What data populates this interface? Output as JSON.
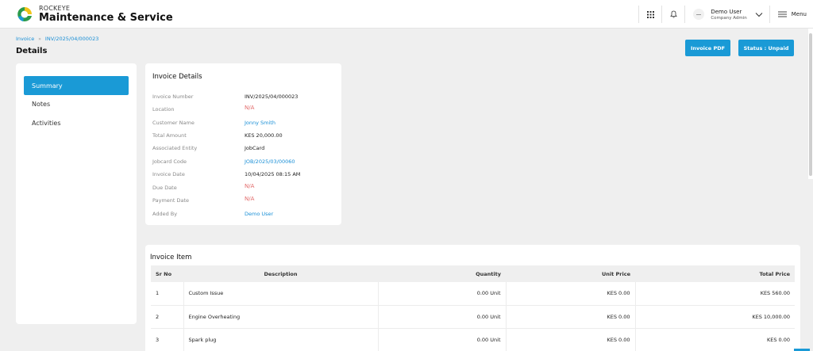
{
  "header": {
    "brand_top": "ROCKEYE",
    "brand_main": "Maintenance & Service",
    "user_name": "Demo User",
    "user_role": "Company Admin",
    "menu_label": "Menu",
    "icons": [
      "rockeye-logo-icon",
      "apps-grid-icon",
      "bell-icon",
      "avatar",
      "chevron-down-icon",
      "hamburger-menu-icon"
    ]
  },
  "breadcrumb": {
    "root": "Invoice",
    "current": "INV/2025/04/000023"
  },
  "page_title": "Details",
  "actions": {
    "invoice_pdf": "Invoice PDF",
    "status": "Status : Unpaid"
  },
  "sidebar": {
    "items": [
      {
        "label": "Summary",
        "active": true
      },
      {
        "label": "Notes",
        "active": false
      },
      {
        "label": "Activities",
        "active": false
      }
    ]
  },
  "invoice_details": {
    "title": "Invoice Details",
    "fields": [
      {
        "label": "Invoice Number",
        "value": "INV/2025/04/000023",
        "style": "text"
      },
      {
        "label": "Location",
        "value": "N/A",
        "style": "na"
      },
      {
        "label": "Customer Name",
        "value": "Jonny Smith",
        "style": "link"
      },
      {
        "label": "Total Amount",
        "value": "KES 20,000.00",
        "style": "text"
      },
      {
        "label": "Associated Entity",
        "value": "JobCard",
        "style": "text"
      },
      {
        "label": "Jobcard Code",
        "value": "JOB/2025/03/00060",
        "style": "link"
      },
      {
        "label": "Invoice Date",
        "value": "10/04/2025 08:15 AM",
        "style": "text"
      },
      {
        "label": "Due Date",
        "value": "N/A",
        "style": "na"
      },
      {
        "label": "Payment Date",
        "value": "N/A",
        "style": "na"
      },
      {
        "label": "Added By",
        "value": "Demo User",
        "style": "link"
      }
    ]
  },
  "invoice_items": {
    "title": "Invoice Item",
    "columns": [
      "Sr No",
      "Description",
      "Quantity",
      "Unit Price",
      "Total Price"
    ],
    "rows": [
      [
        "1",
        "Custom Issue",
        "0.00 Unit",
        "KES 0.00",
        "KES 560.00"
      ],
      [
        "2",
        "Engine Overheating",
        "0.00 Unit",
        "KES 0.00",
        "KES 10,000.00"
      ],
      [
        "3",
        "Spark plug",
        "0.00 Unit",
        "KES 0.00",
        "KES 0.00"
      ]
    ]
  },
  "colors": {
    "accent": "#1a9ad6",
    "link": "#1a8fd6",
    "na": "#e26a6a",
    "background": "#efefef"
  }
}
